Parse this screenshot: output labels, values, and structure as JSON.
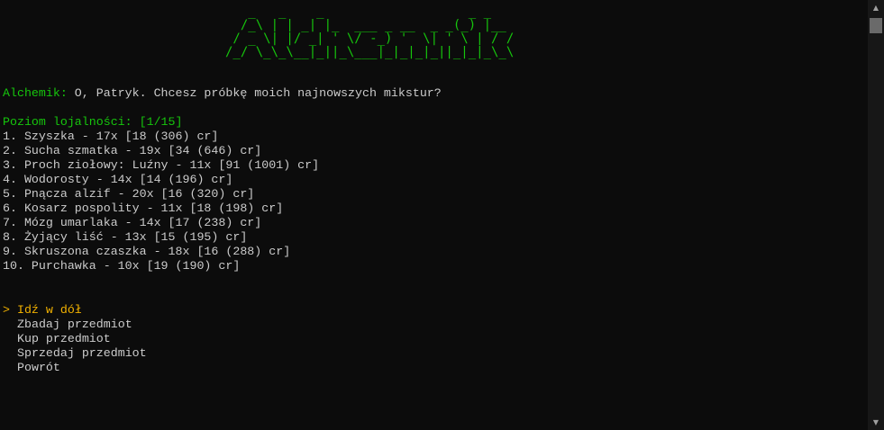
{
  "banner": {
    "art": "   _   _    _                   _ _\n  /_\\ | | _| |_  ___ _ __  _ _(_) |__\n / _ \\| |/ _| ' \\/ -_) '  \\| ' \\ | / /\n/_/ \\_\\_\\__|_||_\\___|_|_|_|_||_|_|_\\_\\"
  },
  "dialog": {
    "speaker": "Alchemik:",
    "text": " O, Patryk. Chcesz próbkę moich najnowszych mikstur?"
  },
  "loyalty": {
    "label": "Poziom lojalności: [1/15]"
  },
  "items": [
    "1. Szyszka - 17x [18 (306) cr]",
    "2. Sucha szmatka - 19x [34 (646) cr]",
    "3. Proch ziołowy: Luźny - 11x [91 (1001) cr]",
    "4. Wodorosty - 14x [14 (196) cr]",
    "5. Pnącza alzif - 20x [16 (320) cr]",
    "6. Kosarz pospolity - 11x [18 (198) cr]",
    "7. Mózg umarlaka - 14x [17 (238) cr]",
    "8. Żyjący liść - 13x [15 (195) cr]",
    "9. Skruszona czaszka - 18x [16 (288) cr]",
    "10. Purchawka - 10x [19 (190) cr]"
  ],
  "menu": {
    "cursor": "> ",
    "selected": "Idź w dół",
    "options": [
      "Zbadaj przedmiot",
      "Kup przedmiot",
      "Sprzedaj przedmiot",
      "Powrót"
    ]
  },
  "scrollbar": {
    "up_icon": "▲",
    "down_icon": "▼"
  }
}
